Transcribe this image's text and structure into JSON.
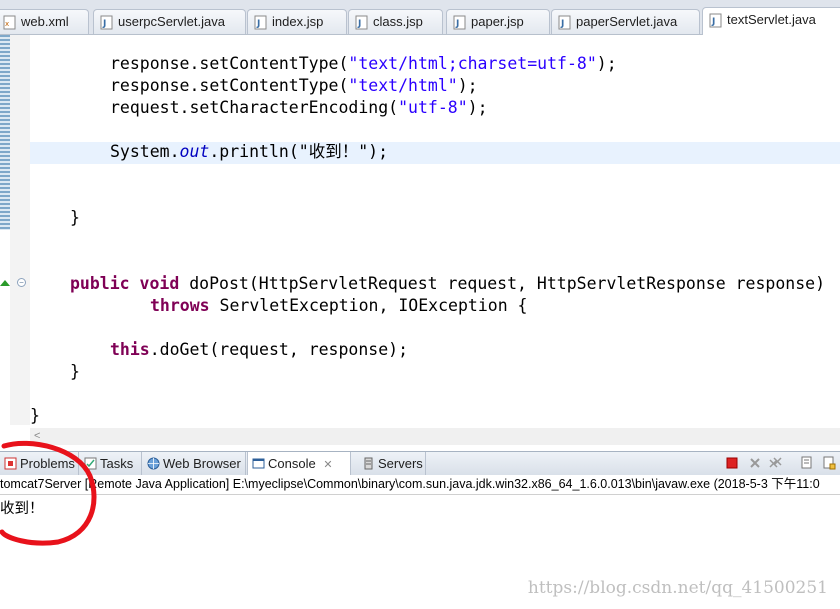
{
  "editor_tabs": [
    {
      "label": "web.xml",
      "icon": "xml-file-icon"
    },
    {
      "label": "userpcServlet.java",
      "icon": "java-file-icon"
    },
    {
      "label": "index.jsp",
      "icon": "jsp-file-icon"
    },
    {
      "label": "class.jsp",
      "icon": "jsp-file-icon"
    },
    {
      "label": "paper.jsp",
      "icon": "jsp-file-icon"
    },
    {
      "label": "paperServlet.java",
      "icon": "java-file-icon"
    },
    {
      "label": "textServlet.java",
      "icon": "java-file-icon",
      "active": true
    }
  ],
  "code": {
    "l1_a": "response.setContentType(",
    "l1_s": "\"text/html;charset=utf-8\"",
    "l1_b": ");",
    "l2_a": "response.setContentType(",
    "l2_s": "\"text/html\"",
    "l2_b": ");",
    "l3_a": "request.setCharacterEncoding(",
    "l3_s": "\"utf-8\"",
    "l3_b": ");",
    "l4_a": "System.",
    "l4_f": "out",
    "l4_b": ".println(\"收到！\");",
    "l5": "}",
    "l6_k1": "public",
    "l6_k2": "void",
    "l6_rest": "doPost(HttpServletRequest request, HttpServletResponse response)",
    "l7_k": "throws",
    "l7_rest": "ServletException, IOException {",
    "l8_k": "this",
    "l8_rest": ".doGet(request, response);",
    "l9": "}",
    "l10": "}"
  },
  "panel_tabs": [
    {
      "label": "Problems",
      "icon": "problems-icon"
    },
    {
      "label": "Tasks",
      "icon": "tasks-icon"
    },
    {
      "label": "Web Browser",
      "icon": "globe-icon"
    },
    {
      "label": "Console",
      "icon": "console-icon",
      "active": true,
      "close": "✕"
    },
    {
      "label": "Servers",
      "icon": "servers-icon"
    }
  ],
  "console": {
    "header": "tomcat7Server [Remote Java Application] E:\\myeclipse\\Common\\binary\\com.sun.java.jdk.win32.x86_64_1.6.0.013\\bin\\javaw.exe (2018-5-3 下午11:0",
    "output": "收到！"
  },
  "watermark": "https://blog.csdn.net/qq_41500251",
  "colors": {
    "keyword": "#7f0055",
    "string": "#2a00ff",
    "field": "#0000c0",
    "annotation_circle": "#e8121b"
  }
}
